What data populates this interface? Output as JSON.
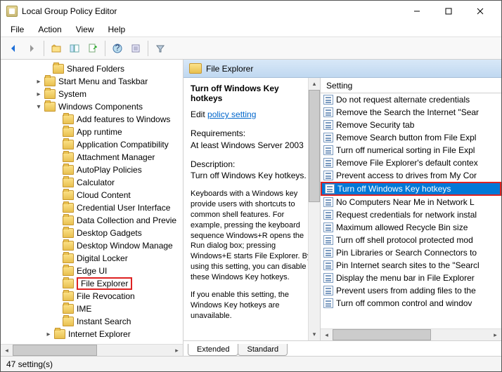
{
  "window": {
    "title": "Local Group Policy Editor"
  },
  "menu": {
    "file": "File",
    "action": "Action",
    "view": "View",
    "help": "Help"
  },
  "tree": {
    "items": [
      {
        "indent": 58,
        "exp": "",
        "label": "Shared Folders"
      },
      {
        "indent": 46,
        "exp": "▸",
        "label": "Start Menu and Taskbar"
      },
      {
        "indent": 46,
        "exp": "▸",
        "label": "System"
      },
      {
        "indent": 46,
        "exp": "▾",
        "label": "Windows Components"
      },
      {
        "indent": 72,
        "exp": "",
        "label": "Add features to Windows"
      },
      {
        "indent": 72,
        "exp": "",
        "label": "App runtime"
      },
      {
        "indent": 72,
        "exp": "",
        "label": "Application Compatibility"
      },
      {
        "indent": 72,
        "exp": "",
        "label": "Attachment Manager"
      },
      {
        "indent": 72,
        "exp": "",
        "label": "AutoPlay Policies"
      },
      {
        "indent": 72,
        "exp": "",
        "label": "Calculator"
      },
      {
        "indent": 72,
        "exp": "",
        "label": "Cloud Content"
      },
      {
        "indent": 72,
        "exp": "",
        "label": "Credential User Interface"
      },
      {
        "indent": 72,
        "exp": "",
        "label": "Data Collection and Previe"
      },
      {
        "indent": 72,
        "exp": "",
        "label": "Desktop Gadgets"
      },
      {
        "indent": 72,
        "exp": "",
        "label": "Desktop Window Manage"
      },
      {
        "indent": 72,
        "exp": "",
        "label": "Digital Locker"
      },
      {
        "indent": 72,
        "exp": "",
        "label": "Edge UI"
      },
      {
        "indent": 72,
        "exp": "",
        "label": "File Explorer",
        "hl": true
      },
      {
        "indent": 72,
        "exp": "",
        "label": "File Revocation"
      },
      {
        "indent": 72,
        "exp": "",
        "label": "IME"
      },
      {
        "indent": 72,
        "exp": "",
        "label": "Instant Search"
      },
      {
        "indent": 60,
        "exp": "▸",
        "label": "Internet Explorer"
      }
    ]
  },
  "detail": {
    "header": "File Explorer",
    "title": "Turn off Windows Key hotkeys",
    "edit_prefix": "Edit ",
    "edit_link": "policy setting",
    "req_label": "Requirements:",
    "req_text": "At least Windows Server 2003",
    "desc_label": "Description:",
    "desc_text": "Turn off Windows Key hotkeys.",
    "para1": "Keyboards with a Windows key provide users with shortcuts to common shell features. For example, pressing the keyboard sequence Windows+R opens the Run dialog box; pressing Windows+E starts File Explorer. By using this setting, you can disable these Windows Key hotkeys.",
    "para2": "If you enable this setting, the Windows Key hotkeys are unavailable."
  },
  "list": {
    "header": "Setting",
    "items": [
      {
        "label": "Do not request alternate credentials"
      },
      {
        "label": "Remove the Search the Internet \"Sear"
      },
      {
        "label": "Remove Security tab"
      },
      {
        "label": "Remove Search button from File Expl"
      },
      {
        "label": "Turn off numerical sorting in File Expl"
      },
      {
        "label": "Remove File Explorer's default contex"
      },
      {
        "label": "Prevent access to drives from My Cor"
      },
      {
        "label": "Turn off Windows Key hotkeys",
        "sel": true
      },
      {
        "label": "No Computers Near Me in Network L"
      },
      {
        "label": "Request credentials for network instal"
      },
      {
        "label": "Maximum allowed Recycle Bin size"
      },
      {
        "label": "Turn off shell protocol protected mod"
      },
      {
        "label": "Pin Libraries or Search Connectors to"
      },
      {
        "label": "Pin Internet search sites to the \"Searcl"
      },
      {
        "label": "Display the menu bar in File Explorer"
      },
      {
        "label": "Prevent users from adding files to the"
      },
      {
        "label": "Turn off common control and windov"
      }
    ]
  },
  "tabs": {
    "extended": "Extended",
    "standard": "Standard"
  },
  "status": "47 setting(s)"
}
